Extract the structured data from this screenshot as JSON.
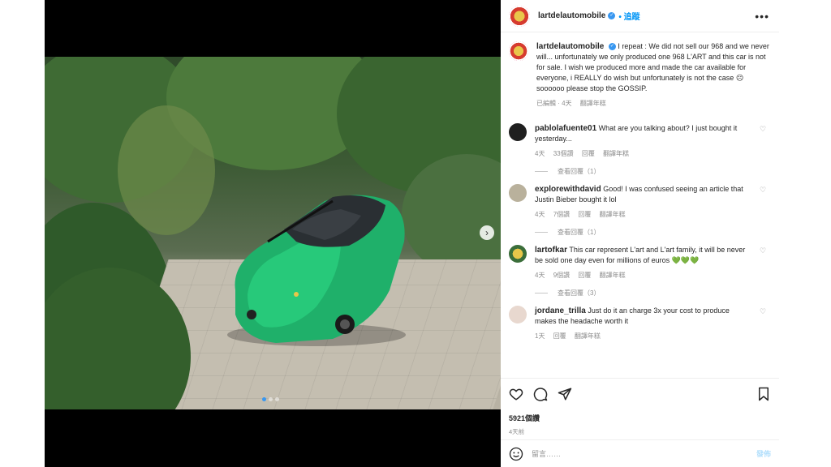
{
  "post": {
    "username": "lartdelautomobile",
    "follow_label": "追蹤",
    "more_icon": "more-icon"
  },
  "caption": {
    "username": "lartdelautomobile",
    "text": "I repeat : We did not sell our 968 and we never will... unfortunately we only produced one 968 L'ART and this car is not for sale. I wish we produced more and made the car available for everyone, i REALLY do wish but unfortunately is not the case ☹ soooooo please stop the GOSSIP.",
    "edited": "已編輯 · 4天",
    "translate": "翻譯年糕"
  },
  "comments": [
    {
      "username": "pablolafuente01",
      "text": "What are you talking about? I just bought it yesterday...",
      "age": "4天",
      "likes": "33個讚",
      "reply": "回覆",
      "translate": "翻譯年糕",
      "view_replies": "查看回覆（1）",
      "avatar_color": "#1f1f1f"
    },
    {
      "username": "explorewithdavid",
      "text": "Good! I was confused seeing an article that Justin Bieber bought it lol",
      "age": "4天",
      "likes": "7個讚",
      "reply": "回覆",
      "translate": "翻譯年糕",
      "view_replies": "查看回覆（1）",
      "avatar_color": "#b9b19c"
    },
    {
      "username": "lartofkar",
      "text": "This car represent L'art and L'art family, it will be never be sold one day even for millions of euros 💚💚💚",
      "age": "4天",
      "likes": "9個讚",
      "reply": "回覆",
      "translate": "翻譯年糕",
      "view_replies": "查看回覆（3）",
      "avatar_color": "#3b6e3a"
    },
    {
      "username": "jordane_trilla",
      "text": "Just do it an charge 3x your cost to produce makes the headache worth it",
      "age": "1天",
      "likes": "",
      "reply": "回覆",
      "translate": "翻譯年糕",
      "view_replies": "",
      "avatar_color": "#e8d8cf"
    }
  ],
  "actions": {
    "like_icon": "heart-icon",
    "comment_icon": "comment-icon",
    "share_icon": "share-icon",
    "save_icon": "bookmark-icon",
    "likes": "5921個讚",
    "time": "4天前"
  },
  "add_comment": {
    "placeholder": "留言……",
    "post_label": "發佈",
    "emoji_icon": "emoji-icon"
  },
  "colors": {
    "accent": "#0095f6",
    "car_green": "#1fb06a"
  }
}
